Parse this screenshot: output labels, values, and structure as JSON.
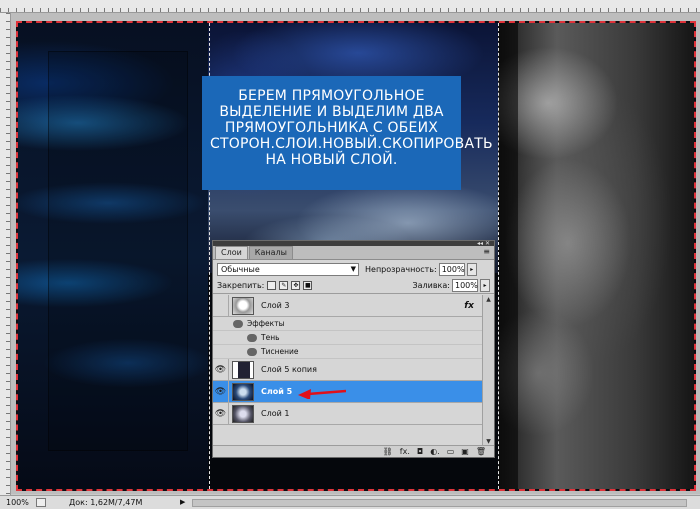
{
  "caption": "БЕРЕМ ПРЯМОУГОЛЬНОЕ ВЫДЕЛЕНИЕ И ВЫДЕЛИМ ДВА ПРЯМОУГОЛЬНИКА С ОБЕИХ СТОРОН.СЛОИ.НОВЫЙ.СКОПИРОВАТЬ НА НОВЫЙ СЛОЙ.",
  "layers_panel": {
    "tabs": [
      {
        "label": "Слои",
        "active": true
      },
      {
        "label": "Каналы",
        "active": false
      }
    ],
    "blend_mode": "Обычные",
    "opacity_label": "Непрозрачность:",
    "opacity_value": "100%",
    "lock_label": "Закрепить:",
    "fill_label": "Заливка:",
    "fill_value": "100%",
    "layers": [
      {
        "name": "Слой 3",
        "visible": false,
        "fx": "fx"
      },
      {
        "name": "Эффекты",
        "kind": "effects-group"
      },
      {
        "name": "Тень",
        "kind": "effect"
      },
      {
        "name": "Тиснение",
        "kind": "effect"
      },
      {
        "name": "Слой 5 копия",
        "visible": true
      },
      {
        "name": "Слой 5",
        "visible": true,
        "selected": true
      },
      {
        "name": "Слой 1",
        "visible": true
      }
    ],
    "bottom_icons": [
      "link-icon",
      "fx-icon",
      "mask-icon",
      "adjustment-icon",
      "group-icon",
      "new-layer-icon",
      "trash-icon"
    ],
    "bottom_glyphs": {
      "link": "⛓",
      "fx": "fx.",
      "mask": "◘",
      "adjust": "◐.",
      "group": "▭",
      "new": "▣",
      "trash": "🗑"
    }
  },
  "statusbar": {
    "zoom": "100%",
    "doc": "Док: 1,62M/7,47M"
  },
  "colors": {
    "caption_bg": "#1b68b8",
    "selection_bg": "#3a8fe8",
    "arrow": "#e0101a",
    "marquee": "#e0333a"
  }
}
